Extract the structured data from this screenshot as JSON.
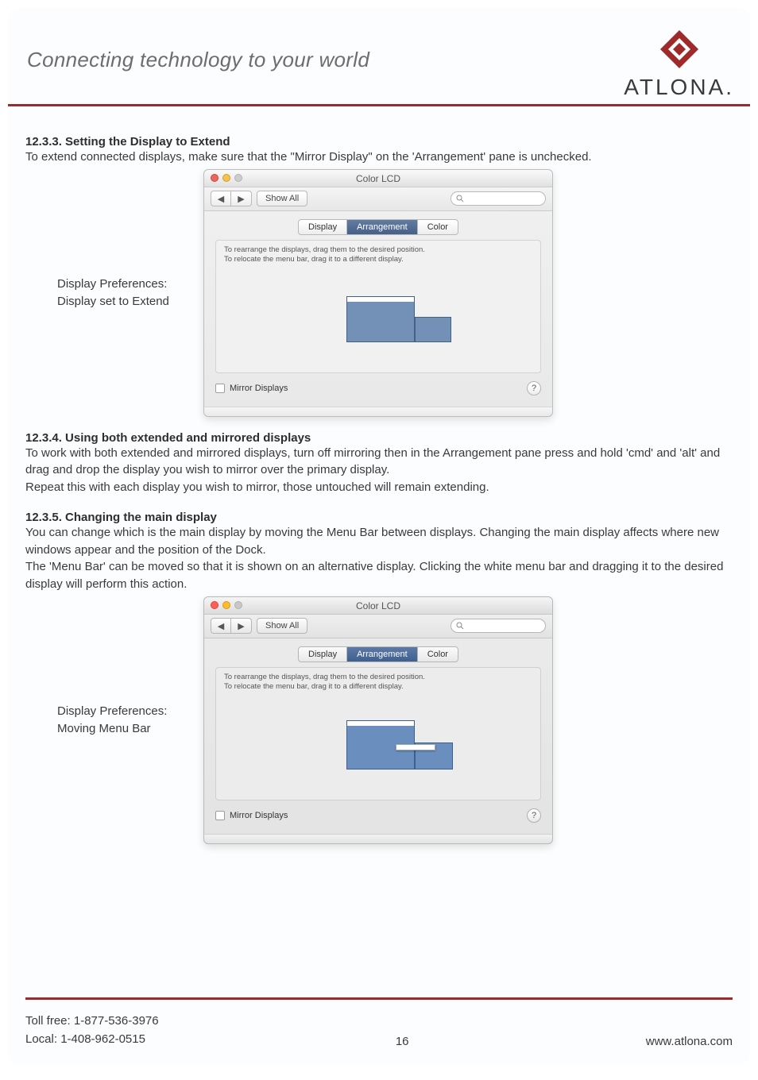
{
  "header": {
    "tagline": "Connecting technology to your world",
    "brand_word": "ATLONA"
  },
  "sections": {
    "s1": {
      "heading": "12.3.3. Setting the Display to Extend",
      "body": "To extend connected displays, make sure that the \"Mirror Display\" on the 'Arrangement' pane is unchecked.",
      "caption_l1": "Display Preferences:",
      "caption_l2": "Display set to Extend"
    },
    "s2": {
      "heading": "12.3.4. Using both extended and mirrored displays",
      "body_l1": "To work with both extended and mirrored displays, turn off mirroring then in the Arrangement pane press and hold 'cmd' and 'alt' and drag and drop the display you wish to mirror over the primary display.",
      "body_l2": "Repeat this with each display you wish to mirror, those untouched will remain extending."
    },
    "s3": {
      "heading": "12.3.5. Changing the main display",
      "body_l1": "You can change which is the main display by moving the Menu Bar between displays. Changing the main display affects where new windows appear and the position of the Dock.",
      "body_l2": "The 'Menu Bar' can be moved so that it is shown on an alternative display. Clicking the white menu bar and dragging it to the desired display will perform this action.",
      "caption_l1": "Display Preferences:",
      "caption_l2": "Moving Menu Bar"
    }
  },
  "macwin": {
    "title": "Color LCD",
    "show_all": "Show All",
    "tabs": {
      "display": "Display",
      "arrangement": "Arrangement",
      "color": "Color"
    },
    "hint_l1": "To rearrange the displays, drag them to the desired position.",
    "hint_l2": "To relocate the menu bar, drag it to a different display.",
    "mirror_label": "Mirror Displays",
    "help_glyph": "?",
    "nav_back": "◀",
    "nav_fwd": "▶",
    "search_placeholder": ""
  },
  "footer": {
    "toll_free": "Toll free: 1-877-536-3976",
    "local": "Local: 1-408-962-0515",
    "page_number": "16",
    "site": "www.atlona.com"
  },
  "colors": {
    "accent": "#9e2a2b"
  }
}
